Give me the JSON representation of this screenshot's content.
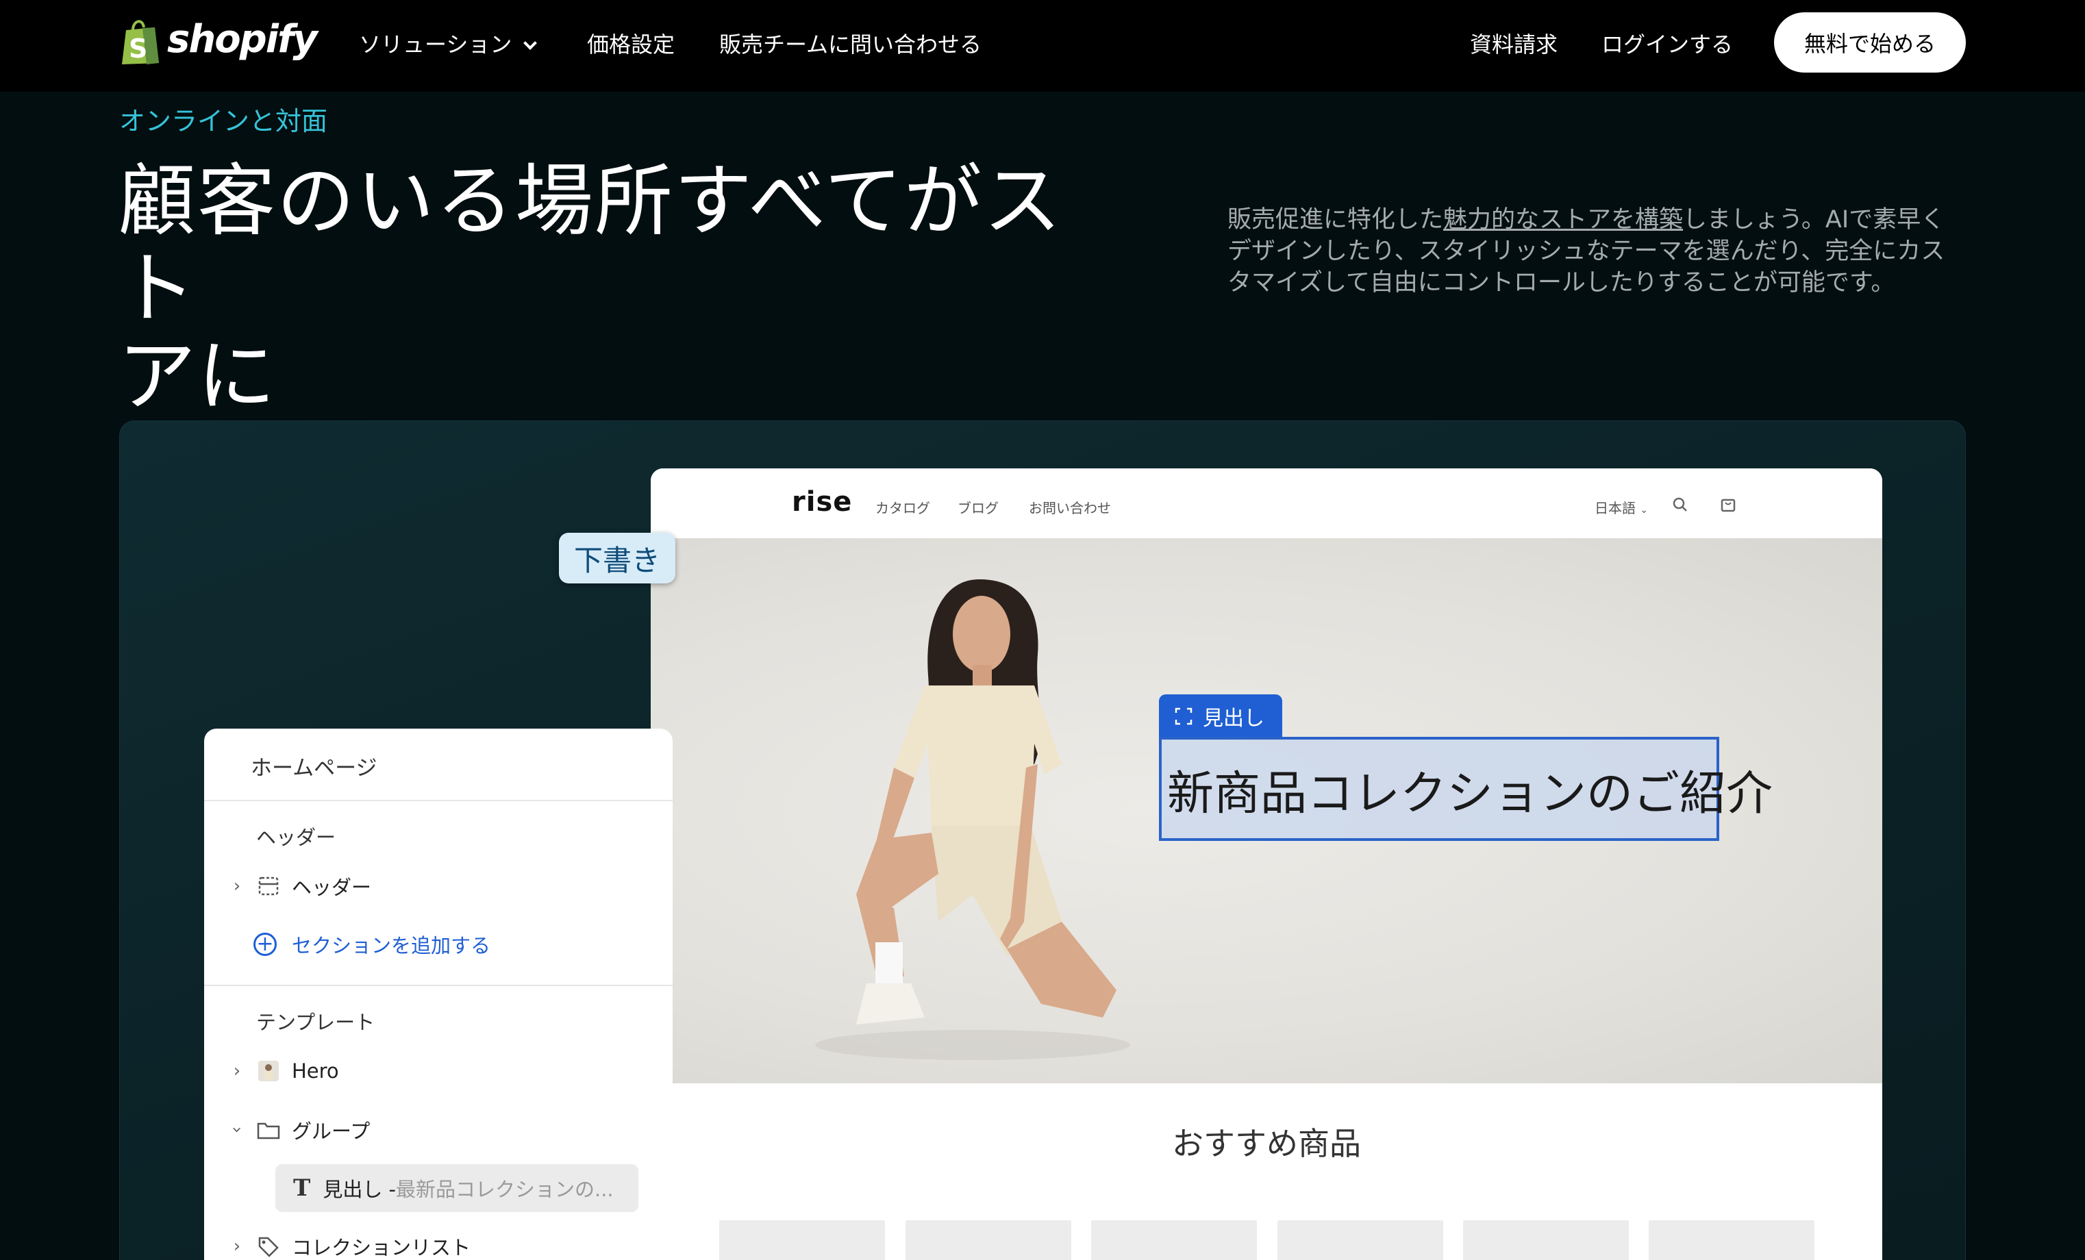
{
  "nav": {
    "brand": "shopify",
    "links": [
      "ソリューション",
      "価格設定",
      "販売チームに問い合わせる"
    ],
    "right_links": [
      "資料請求",
      "ログインする"
    ],
    "cta": "無料で始める"
  },
  "hero": {
    "eyebrow": "オンラインと対面",
    "headline_line1": "顧客のいる場所すべてがスト",
    "headline_line2": "アに",
    "desc_before": "販売促進に特化した",
    "desc_link": "魅力的なストアを構築",
    "desc_after": "しましょう。AIで素早くデザインしたり、スタイリッシュなテーマを選んだり、完全にカスタマイズして自由にコントロールしたりすることが可能です。"
  },
  "store": {
    "logo": "rise",
    "links": [
      "カタログ",
      "ブログ",
      "お問い合わせ"
    ],
    "language": "日本語",
    "heading_tag": "見出し",
    "heading_text": "新商品コレクションのご紹介",
    "featured": "おすすめ商品"
  },
  "draft_badge": "下書き",
  "editor": {
    "title": "ホームページ",
    "header_section": "ヘッダー",
    "header_item": "ヘッダー",
    "add_section": "セクションを追加する",
    "template_section": "テンプレート",
    "hero_item": "Hero",
    "group_item": "グループ",
    "heading_item": "見出し - ",
    "heading_item_detail": "最新品コレクションの...",
    "collection_item": "コレクションリスト"
  },
  "colors": {
    "accent_teal": "#35c3d8",
    "editor_blue": "#1f5fd3",
    "shopify_green": "#95bf47"
  }
}
